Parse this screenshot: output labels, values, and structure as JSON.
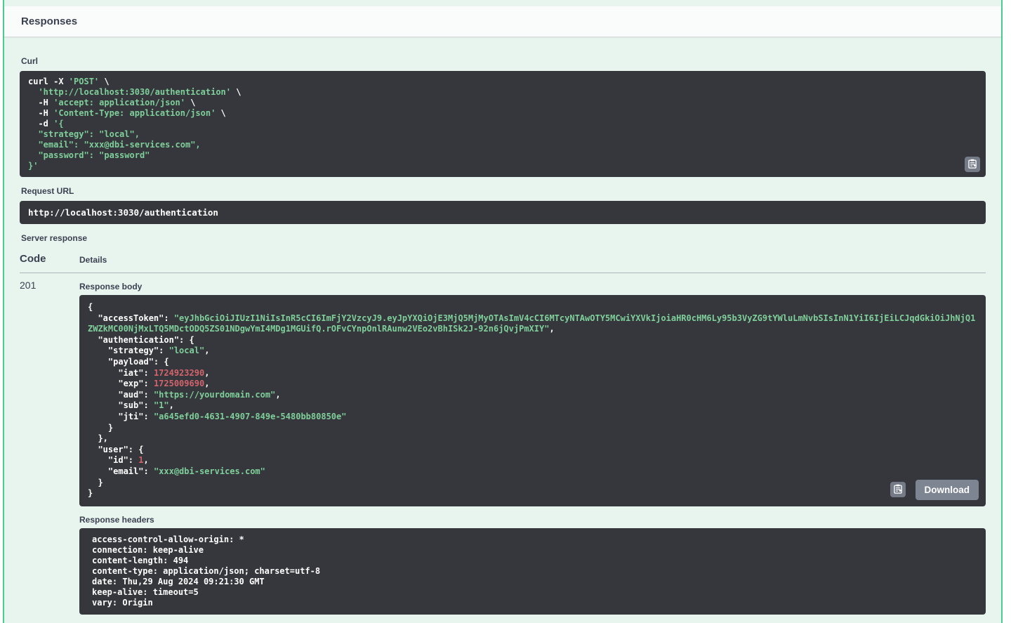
{
  "colors": {
    "post_accent_green": "#49cc90",
    "opblock_background": "#e8f4ee",
    "code_block_background": "#35373c",
    "string_green": "#7fcf9a",
    "number_red": "#d4646c",
    "label_text": "#3b4151",
    "button_gray": "#7d8492"
  },
  "icons": {
    "curl_copy": "clipboard-copy-icon",
    "body_copy": "clipboard-copy-icon"
  },
  "responses_header": {
    "title": "Responses"
  },
  "curl": {
    "label": "Curl",
    "lines": [
      [
        [
          "p",
          "curl -X "
        ],
        [
          "s",
          "'POST'"
        ],
        [
          "p",
          " \\"
        ]
      ],
      [
        [
          "p",
          "  "
        ],
        [
          "s",
          "'http://localhost:3030/authentication'"
        ],
        [
          "p",
          " \\"
        ]
      ],
      [
        [
          "p",
          "  -H "
        ],
        [
          "s",
          "'accept: application/json'"
        ],
        [
          "p",
          " \\"
        ]
      ],
      [
        [
          "p",
          "  -H "
        ],
        [
          "s",
          "'Content-Type: application/json'"
        ],
        [
          "p",
          " \\"
        ]
      ],
      [
        [
          "p",
          "  -d "
        ],
        [
          "s",
          "'{"
        ]
      ],
      [
        [
          "s",
          "  \"strategy\": \"local\","
        ]
      ],
      [
        [
          "s",
          "  \"email\": \"xxx@dbi-services.com\","
        ]
      ],
      [
        [
          "s",
          "  \"password\": \"password\""
        ]
      ],
      [
        [
          "s",
          "}'"
        ]
      ]
    ]
  },
  "request_url": {
    "label": "Request URL",
    "value": "http://localhost:3030/authentication"
  },
  "server_response": {
    "label": "Server response",
    "code_header": "Code",
    "details_header": "Details",
    "status_code": "201"
  },
  "response_body": {
    "label": "Response body",
    "download_label": "Download",
    "lines": [
      [
        [
          "p",
          "{"
        ]
      ],
      [
        [
          "p",
          "  \"accessToken\": "
        ],
        [
          "s",
          "\"eyJhbGciOiJIUzI1NiIsInR5cCI6ImFjY2VzcyJ9.eyJpYXQiOjE3MjQ5MjMyOTAsImV4cCI6MTcyNTAwOTY5MCwiYXVkIjoiaHR0cHM6Ly95b3VyZG9tYWluLmNvbSIsInN1YiI6IjEiLCJqdGkiOiJhNjQ1ZWZkMC00NjMxLTQ5MDctODQ5ZS01NDgwYmI4MDg1MGUifQ.rOFvCYnpOnlRAunw2VEo2vBhISk2J-92n6jQvjPmXIY\""
        ],
        [
          "p",
          ","
        ]
      ],
      [
        [
          "p",
          "  \"authentication\": {"
        ]
      ],
      [
        [
          "p",
          "    \"strategy\": "
        ],
        [
          "s",
          "\"local\""
        ],
        [
          "p",
          ","
        ]
      ],
      [
        [
          "p",
          "    \"payload\": {"
        ]
      ],
      [
        [
          "p",
          "      \"iat\": "
        ],
        [
          "n",
          "1724923290"
        ],
        [
          "p",
          ","
        ]
      ],
      [
        [
          "p",
          "      \"exp\": "
        ],
        [
          "n",
          "1725009690"
        ],
        [
          "p",
          ","
        ]
      ],
      [
        [
          "p",
          "      \"aud\": "
        ],
        [
          "s",
          "\"https://yourdomain.com\""
        ],
        [
          "p",
          ","
        ]
      ],
      [
        [
          "p",
          "      \"sub\": "
        ],
        [
          "s",
          "\"1\""
        ],
        [
          "p",
          ","
        ]
      ],
      [
        [
          "p",
          "      \"jti\": "
        ],
        [
          "s",
          "\"a645efd0-4631-4907-849e-5480bb80850e\""
        ]
      ],
      [
        [
          "p",
          "    }"
        ]
      ],
      [
        [
          "p",
          "  },"
        ]
      ],
      [
        [
          "p",
          "  \"user\": {"
        ]
      ],
      [
        [
          "p",
          "    \"id\": "
        ],
        [
          "n",
          "1"
        ],
        [
          "p",
          ","
        ]
      ],
      [
        [
          "p",
          "    \"email\": "
        ],
        [
          "s",
          "\"xxx@dbi-services.com\""
        ]
      ],
      [
        [
          "p",
          "  }"
        ]
      ],
      [
        [
          "p",
          "}"
        ]
      ]
    ]
  },
  "response_headers": {
    "label": "Response headers",
    "lines": [
      [
        [
          "p",
          "access-control-allow-origin: *"
        ]
      ],
      [
        [
          "p",
          "connection: keep-alive"
        ]
      ],
      [
        [
          "p",
          "content-length: 494"
        ]
      ],
      [
        [
          "p",
          "content-type: application/json; charset=utf-8"
        ]
      ],
      [
        [
          "p",
          "date: Thu,29 Aug 2024 09:21:30 GMT"
        ]
      ],
      [
        [
          "p",
          "keep-alive: timeout=5"
        ]
      ],
      [
        [
          "p",
          "vary: Origin"
        ]
      ]
    ]
  }
}
